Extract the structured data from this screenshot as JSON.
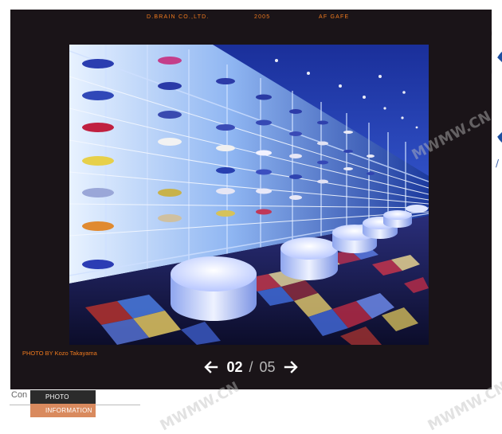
{
  "header": {
    "company": "D.BRAIN CO.,LTD.",
    "year": "2005",
    "project": "AF GAFE"
  },
  "photo": {
    "credit": "PHOTO BY Kozo Takayama",
    "alt": "Interior with illuminated sneaker display wall and white round stools on checkered carpet"
  },
  "pager": {
    "current": "02",
    "separator": "/",
    "total": "05",
    "prev_icon": "arrow-left-icon",
    "next_icon": "arrow-right-icon"
  },
  "tabs": {
    "photo_label": "PHOTO",
    "information_label": "INFORMATION"
  },
  "background": {
    "content_label": "Con",
    "watermark": "MWMW.CN"
  },
  "colors": {
    "accent_orange": "#f07a1e",
    "lightbox_bg": "#1a1418",
    "info_tab": "#d98a5e",
    "photo_tab": "#2b2b2b"
  }
}
